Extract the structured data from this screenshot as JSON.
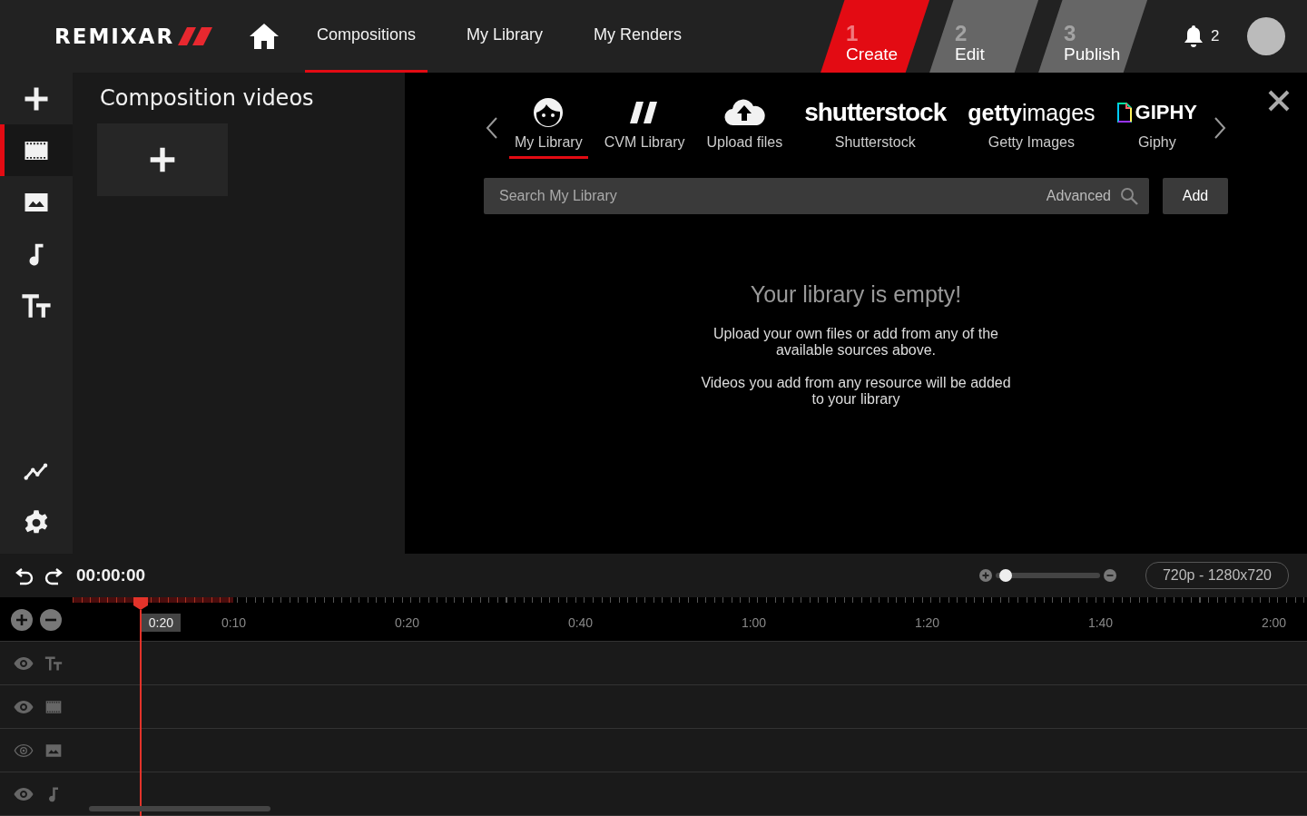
{
  "header": {
    "logo": "REMIXAR",
    "nav": [
      {
        "label": "Compositions",
        "selected": true
      },
      {
        "label": "My Library",
        "selected": false
      },
      {
        "label": "My Renders",
        "selected": false
      }
    ],
    "steps": [
      {
        "number": "1",
        "label": "Create",
        "selected": true
      },
      {
        "number": "2",
        "label": "Edit",
        "selected": false
      },
      {
        "number": "3",
        "label": "Publish",
        "selected": false
      }
    ],
    "notifications": "2"
  },
  "rail": {
    "items": [
      {
        "kind": "add",
        "selected": false
      },
      {
        "kind": "video",
        "selected": true
      },
      {
        "kind": "image",
        "selected": false
      },
      {
        "kind": "audio",
        "selected": false
      },
      {
        "kind": "text",
        "selected": false
      }
    ],
    "bottom": [
      {
        "kind": "chart"
      },
      {
        "kind": "settings"
      }
    ]
  },
  "panel": {
    "title": "Composition videos"
  },
  "sources": [
    {
      "kind": "my-library",
      "label": "My Library",
      "selected": true
    },
    {
      "kind": "cvm",
      "label": "CVM Library",
      "selected": false
    },
    {
      "kind": "upload",
      "label": "Upload files",
      "selected": false
    },
    {
      "kind": "shutterstock",
      "logo": "shutterstock",
      "label": "Shutterstock",
      "selected": false
    },
    {
      "kind": "getty",
      "logo": "**getty**images",
      "label": "Getty Images",
      "selected": false
    },
    {
      "kind": "giphy",
      "logo": "GIPHY",
      "label": "Giphy",
      "selected": false
    }
  ],
  "search": {
    "placeholder": "Search My Library",
    "advanced": "Advanced",
    "add": "Add"
  },
  "empty": {
    "title": "Your library is empty!",
    "paragraphs": [
      "Upload your own files or add from any of the available sources above.",
      "Videos you add from any resource will be added to your library"
    ]
  },
  "timeline": {
    "time": "00:00:00",
    "zoom": {
      "level": 0.1
    },
    "resolution": "720p - 1280x720",
    "progress": {
      "level": 0.13
    },
    "playhead": {
      "label": "0:20",
      "level": 0.055
    },
    "ticks": [
      "0:10",
      "0:20",
      "0:40",
      "1:00",
      "1:20",
      "1:40",
      "2:00"
    ],
    "tracks": [
      {
        "kind": "text",
        "visible": true
      },
      {
        "kind": "video",
        "visible": true
      },
      {
        "kind": "image",
        "visible": false
      },
      {
        "kind": "audio",
        "visible": true
      }
    ]
  }
}
